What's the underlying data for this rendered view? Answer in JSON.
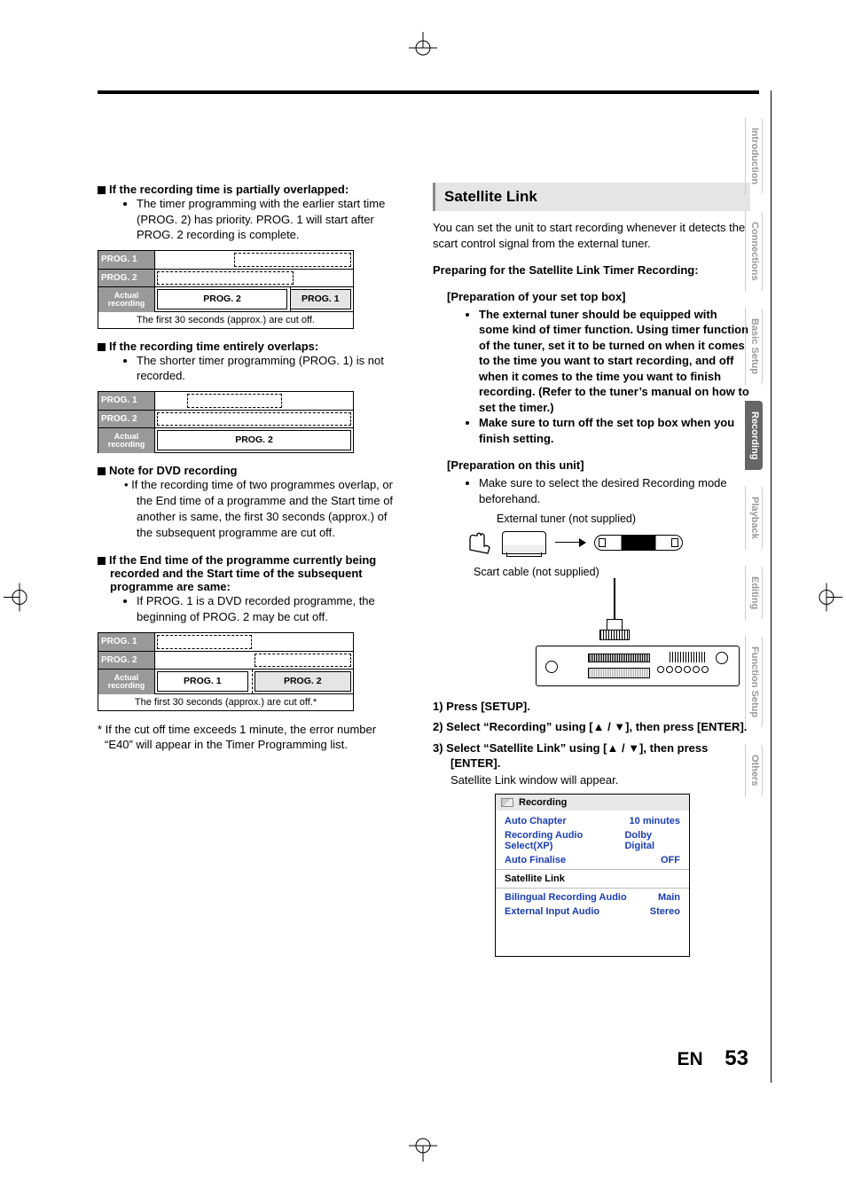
{
  "left": {
    "h1": "If the recording time is partially overlapped:",
    "b1": "The timer programming with the earlier start time (PROG. 2) has priority. PROG. 1 will start after PROG. 2 recording is complete.",
    "d1": {
      "r1": "PROG. 1",
      "r2": "PROG. 2",
      "r3a": "Actual",
      "r3b": "recording",
      "bar_r3_a": "PROG. 2",
      "bar_r3_b": "PROG. 1",
      "foot": "The first 30 seconds (approx.) are cut off."
    },
    "h2": "If the recording time entirely overlaps:",
    "b2": "The shorter timer programming (PROG. 1) is not recorded.",
    "d2": {
      "r1": "PROG. 1",
      "r2": "PROG. 2",
      "r3a": "Actual",
      "r3b": "recording",
      "bar_r3": "PROG. 2"
    },
    "h3": "Note for DVD recording",
    "b3": "If the recording time of two programmes overlap, or the End time of a programme and the Start time of another is same, the first 30 seconds (approx.) of the subsequent programme are cut off.",
    "h4": "If the End time of the programme currently being recorded and the Start time of the subsequent programme are same:",
    "b4": "If PROG. 1 is a DVD recorded programme, the beginning of PROG. 2 may be cut off.",
    "d3": {
      "r1": "PROG. 1",
      "r2": "PROG. 2",
      "r3a": "Actual",
      "r3b": "recording",
      "bar_r3_a": "PROG. 1",
      "bar_r3_b": "PROG. 2",
      "foot": "The first 30 seconds (approx.) are cut off.*"
    },
    "footnote": "* If the cut off time exceeds 1 minute, the error number “E40” will appear in the Timer Programming list."
  },
  "right": {
    "title": "Satellite Link",
    "intro": "You can set the unit to start recording whenever it detects the scart control signal from the external tuner.",
    "prep_title": "Preparing for the Satellite Link Timer Recording:",
    "prep1_head": "[Preparation of your set top box]",
    "prep1_b1": "The external tuner should be equipped with some kind of timer function. Using timer function of the tuner, set it to be turned on when it comes to the time you want to start recording, and off when it comes to the time you want to finish recording. (Refer to the tuner’s manual on how to set the timer.)",
    "prep1_b2": "Make sure to turn off the set top box when you finish setting.",
    "prep2_head": "[Preparation on this unit]",
    "prep2_b1": "Make sure to select the desired Recording mode beforehand.",
    "illus_label1": "External tuner (not supplied)",
    "illus_label2": "Scart cable (not supplied)",
    "step1": "1) Press [SETUP].",
    "step2": "2) Select “Recording” using [▲ / ▼], then press [ENTER].",
    "step3": "3) Select “Satellite Link” using [▲ / ▼], then press [ENTER].",
    "step3_sub": "Satellite Link window will appear.",
    "menu": {
      "head": "Recording",
      "rows": [
        {
          "l": "Auto Chapter",
          "r": "10 minutes"
        },
        {
          "l": "Recording Audio Select(XP)",
          "r": "Dolby Digital"
        },
        {
          "l": "Auto Finalise",
          "r": "OFF"
        }
      ],
      "mid": {
        "l": "Satellite Link",
        "r": ""
      },
      "rows2": [
        {
          "l": "Bilingual Recording Audio",
          "r": "Main"
        },
        {
          "l": "External Input Audio",
          "r": "Stereo"
        }
      ]
    }
  },
  "tabs": [
    "Introduction",
    "Connections",
    "Basic Setup",
    "Recording",
    "Playback",
    "Editing",
    "Function Setup",
    "Others"
  ],
  "active_tab": 3,
  "footer": {
    "lang": "EN",
    "page": "53"
  }
}
